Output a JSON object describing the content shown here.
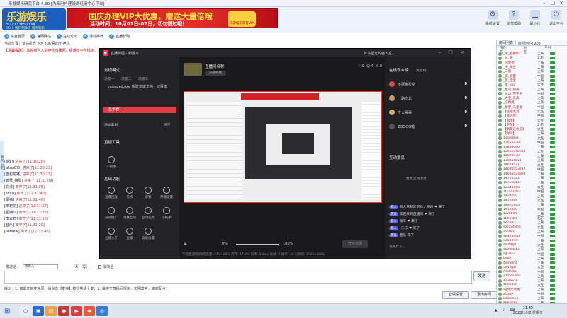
{
  "window": {
    "title": "乐游娱乐研究平台 4.30 [为新用户建设群组织中心平台]"
  },
  "logo": {
    "brand": "乐游娱乐",
    "url": "HD.FXT365.COM",
    "slogan": "2013 我们无障碍 服务到家"
  },
  "ad": {
    "headline": "国庆办理VIP大优惠，赠送大量倍哦",
    "subline": "活动时间：10月01日-07日，切勿错过哦！",
    "emblem": "乐游娱乐荣誉VIP"
  },
  "top_icons": [
    {
      "label": "系统设置",
      "icon": "gear-icon"
    },
    {
      "label": "给优帮助",
      "icon": "help-icon"
    },
    {
      "label": "最小化",
      "icon": "minimize-icon"
    },
    {
      "label": "退出平台",
      "icon": "exit-icon"
    }
  ],
  "toolbar": [
    {
      "label": "平台首页",
      "icon": "home-icon"
    },
    {
      "label": "官网网站",
      "icon": "web-icon"
    },
    {
      "label": "在线论坛",
      "icon": "forum-icon"
    },
    {
      "label": "活动推荐",
      "icon": "gift-icon"
    },
    {
      "label": "直播帮助",
      "icon": "help-icon"
    }
  ],
  "path": "当前位置：梦乌星光 >> 306语音厅-声优",
  "broadcast": "【温馨提醒】 欢迎新人入驻声卡直播间，请遵守平台规定，文明聊天，严禁发布广告信息及违规内容…",
  "side_tab": "聊天 历史",
  "chat": [
    {
      "user": "[梦幻]",
      "text": "进来了[11:30:28]"
    },
    {
      "user": "[akuaBI0]",
      "text": "进来了[11:30:23]"
    },
    {
      "user": "[面包花路]",
      "text": "进来了[11:30:27]"
    },
    {
      "user": "[螃蟹_猫星]",
      "text": "进来了[11:31:09]"
    },
    {
      "user": "[彩漫]",
      "text": "离开了[11:31:05]"
    },
    {
      "user": "[sdxu]",
      "text": "离开了[11:31:40]"
    },
    {
      "user": "[豪猪]",
      "text": "进来了[11:31:40]"
    },
    {
      "user": "[茉莉花]",
      "text": "进来了[11:31:17]"
    },
    {
      "user": "[星期四]",
      "text": "离开了[11:31:33]"
    },
    {
      "user": "[李云鹤]",
      "text": "离开了[11:31:13]"
    },
    {
      "user": "[音乐]",
      "text": "离开了[11:31:20]"
    },
    {
      "user": "[Mimew]",
      "text": "离开了[11:31:46]"
    }
  ],
  "input": {
    "target_label": "发送给：",
    "target_value": "所有人",
    "private_label": "悄悄话",
    "send_label": "发送"
  },
  "tip": "提示：1. 如需开启麦克风，请点击【麦序】按钮申请上麦；2. 请遵守直播间规定，文明发言，谢谢配合！",
  "bottom_buttons": [
    "音效设置",
    "退出房间"
  ],
  "right_panel": {
    "tabs": [
      "房间列表",
      "房间用户(920)"
    ],
    "headers": [
      "用户名",
      "地区",
      "Flag"
    ],
    "users": [
      {
        "name": "_冰_若慕如",
        "region": "上海"
      },
      {
        "name": "_冰_天",
        "region": "北京"
      },
      {
        "name": "_鸿星亭",
        "region": "上海"
      },
      {
        "name": "_中_尾台",
        "region": "上海"
      },
      {
        "name": "_三留",
        "region": "上海"
      },
      {
        "name": "_嗯_初夏",
        "region": "中国"
      },
      {
        "name": "_梦_佳宝",
        "region": "上海"
      },
      {
        "name": "_蛋_ooo",
        "region": "大连"
      },
      {
        "name": "_星山_网来",
        "region": "上海"
      },
      {
        "name": "_冰山_亚亚尼",
        "region": "中国"
      },
      {
        "name": "_大宝_乐高",
        "region": "上海"
      },
      {
        "name": "_小精灵",
        "region": "上海"
      },
      {
        "name": "_蒙梦_乌星星",
        "region": "中国"
      },
      {
        "name": "【喵喵无为】",
        "region": "大连"
      },
      {
        "name": "【级入月】",
        "region": "中国"
      },
      {
        "name": "【落落】",
        "region": "大连"
      },
      {
        "name": "【学员】",
        "region": "北京"
      },
      {
        "name": "【明年还会见】",
        "region": "大连"
      },
      {
        "name": "【时间】",
        "region": "上海"
      },
      {
        "name": "11ses8a3",
        "region": "大连"
      },
      {
        "name": "130S5e30",
        "region": "中国"
      },
      {
        "name": "13880040",
        "region": "上海"
      },
      {
        "name": "12966946314",
        "region": "大连"
      },
      {
        "name": "12099030",
        "region": "上海"
      },
      {
        "name": "130055811",
        "region": "上海"
      },
      {
        "name": "14019531",
        "region": "大连"
      },
      {
        "name": "14030453717",
        "region": "中国"
      },
      {
        "name": "14085033939",
        "region": "上海"
      },
      {
        "name": "14776521",
        "region": "上海"
      },
      {
        "name": "18T56011",
        "region": "上海"
      },
      {
        "name": "1Z34d000",
        "region": "大连"
      },
      {
        "name": "1t51e1d87",
        "region": "中国"
      },
      {
        "name": "14Z4kd0",
        "region": "上海"
      },
      {
        "name": "14T0488",
        "region": "大连"
      },
      {
        "name": "14SR0h04",
        "region": "上海"
      },
      {
        "name": "18123a0",
        "region": "中国"
      },
      {
        "name": "1sv6k0d",
        "region": "上海"
      },
      {
        "name": "1E6o5b1",
        "region": "北京"
      },
      {
        "name": "sxlc8A3",
        "region": "上海"
      },
      {
        "name": "sos0v4B00",
        "region": "大连"
      },
      {
        "name": "s5E0s1",
        "region": "上海"
      },
      {
        "name": "4E4Ze90B",
        "region": "中国"
      },
      {
        "name": "5a53044",
        "region": "上海"
      },
      {
        "name": "sb20Bj8",
        "region": "大连"
      },
      {
        "name": "sb200B43",
        "region": "上海"
      },
      {
        "name": "sgO3Ev",
        "region": "中国"
      },
      {
        "name": "6s20",
        "region": "上海"
      },
      {
        "name": "4xn60n4",
        "region": "上海"
      },
      {
        "name": "5E4ng8l",
        "region": "大连"
      },
      {
        "name": "AcsL9b6",
        "region": "中国"
      },
      {
        "name": "Z1Z3B3ms",
        "region": "上海"
      },
      {
        "name": "Xwa6Exo",
        "region": "上海"
      },
      {
        "name": "46003Sb",
        "region": "大连"
      },
      {
        "name": "aiJ文大地图",
        "region": "上海"
      },
      {
        "name": "zslaaP",
        "region": "中国"
      },
      {
        "name": "Bs35m14",
        "region": "上海"
      },
      {
        "name": "applysex",
        "region": "上海"
      }
    ]
  },
  "live": {
    "app_title": "直播伴侣 - 新版本",
    "anchor": "梦乌星光的鹿人盒二",
    "mode_title": "常规模式",
    "scenes_label": "场景一",
    "scene2_label": "场景二",
    "scene3_label": "场景三",
    "scenes": [
      "notepad.exe 新建文本文档 - 记事本",
      "显示器1"
    ],
    "add_material": "添加素材",
    "cleanup": "清空",
    "tools_title": "直播工具",
    "mic_label": "小助手",
    "features_title": "基础功能",
    "features": [
      "直播回放",
      "音乐",
      "房管",
      "开播设置",
      "游戏推广",
      "视频互动",
      "互动任务",
      "小程序",
      "主播大厅",
      "直播",
      "高级设置"
    ],
    "room_name": "直播间名称",
    "room_sub": "开播标题",
    "likes": "0",
    "fans": "4",
    "gifts": "0",
    "volume_left": "0%",
    "volume_right": "100%",
    "start_button": "开始直播",
    "status": "不稳定(您的网络质量)   CPU: 26%   内存: 47.9%   码率: 0kbps   丢帧: 0   帧率: 30   分辨率: 1920x1080",
    "online_title": "在线观众榜",
    "online_tab2": "贡献榜",
    "viewers": [
      {
        "name": "不哭笑星空",
        "count": "0",
        "color": "#e04a4a"
      },
      {
        "name": "一路向北",
        "count": "0",
        "color": "#c9a057"
      },
      {
        "name": "王大哥哥",
        "count": "0",
        "color": "#d4b05a"
      },
      {
        "name": "ZOOOO哦",
        "count": "0",
        "color": "#555"
      }
    ],
    "chat_title": "互动消息",
    "chat_empty": "暂无互动消息",
    "messages": [
      {
        "badge": "新人",
        "text": "新人驾到欢迎你，乐哈 ❤ 来了"
      },
      {
        "badge": "贵宾",
        "text": "欢迎来到直播间 ❤ 来了"
      },
      {
        "badge": "新人",
        "text": "张三 ❤ 来了"
      },
      {
        "badge": "新人",
        "text": "_乐乐 ❤ 来了"
      },
      {
        "badge": "贵宾",
        "text": "音乐 来了"
      }
    ],
    "chat_placeholder": "说点什么..."
  },
  "taskbar": {
    "time": "11:45",
    "date": "2020/10/2 星期五"
  }
}
